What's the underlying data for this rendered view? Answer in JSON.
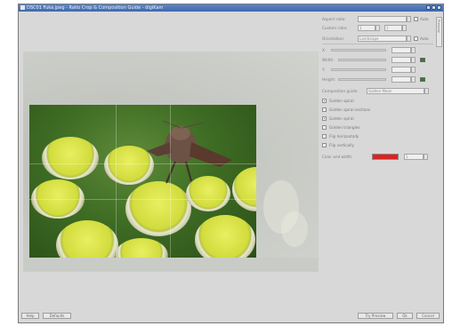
{
  "window": {
    "title": "DSC01 Fuka.jpeg - Ratio Crop & Composition Guide - digiKam"
  },
  "panel": {
    "aspect_ratio_label": "Aspect ratio:",
    "aspect_ratio_value": "",
    "auto_label": "Auto",
    "aspect_label_2": "Custom ratio:",
    "ratio_a": "1",
    "ratio_b": "1",
    "orientation_label": "Orientation:",
    "orientation_value": "Landscape",
    "auto2_label": "Auto",
    "x_label": "X:",
    "x_value": "",
    "width_label": "Width:",
    "width_value": "",
    "y_label": "Y:",
    "y_value": "",
    "height_label": "Height:",
    "height_value": "",
    "guide_label": "Composition guide:",
    "guide_value": "Golden Mean",
    "options": [
      {
        "label": "Golden spiral",
        "checked": true
      },
      {
        "label": "Golden spiral sections",
        "checked": false
      },
      {
        "label": "Golden spiral",
        "checked": true
      },
      {
        "label": "Golden triangles",
        "checked": false
      },
      {
        "label": "Flip horizontally",
        "checked": false
      },
      {
        "label": "Flip vertically",
        "checked": false
      }
    ],
    "color_label": "Color and width:",
    "color_value": "#dd2222",
    "width_num": "1"
  },
  "vtab": {
    "label": "Preview"
  },
  "buttons": {
    "help": "Help",
    "defaults": "Defaults",
    "try": "Try Preview",
    "ok": "Ok",
    "cancel": "Cancel"
  },
  "colors": {
    "accent": "#3e69ad",
    "swatch_green": "#2f7d2f",
    "guide_red": "#dd2222"
  }
}
